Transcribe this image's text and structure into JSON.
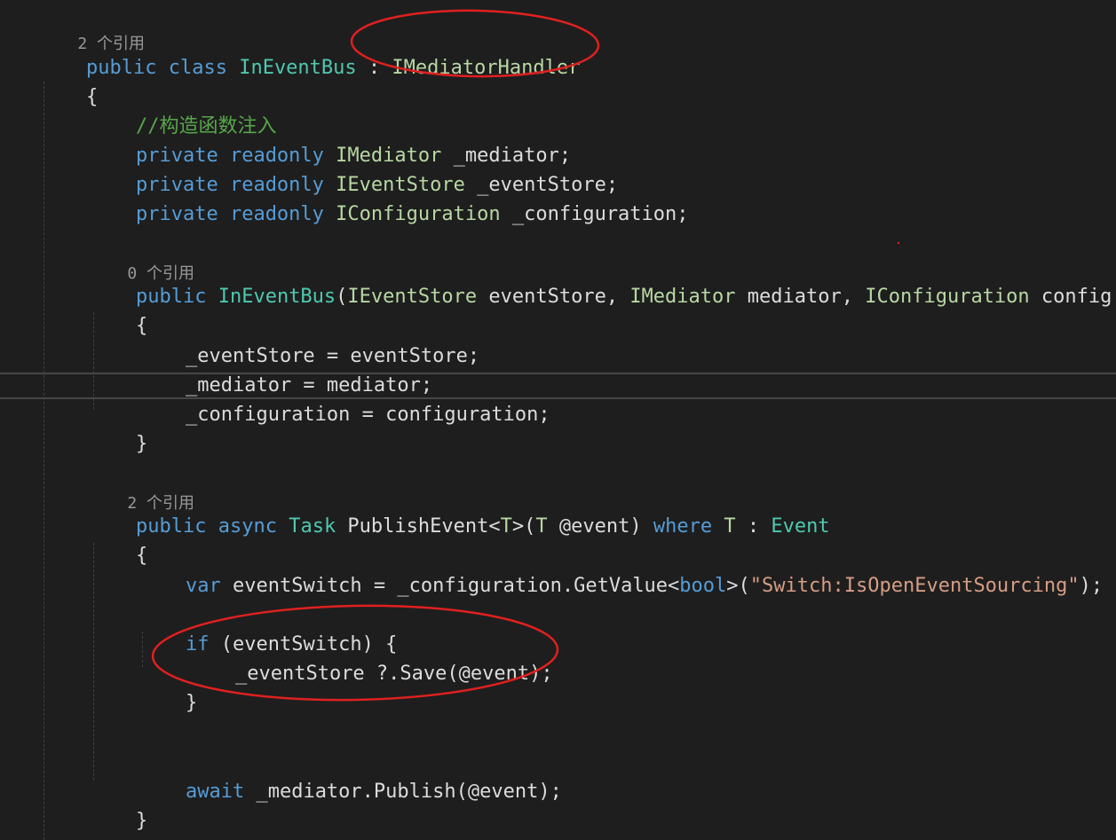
{
  "colors": {
    "background": "#1e1e1e",
    "keyword": "#569cd6",
    "type": "#4ec9b0",
    "interface": "#b8d7a3",
    "identifier": "#dcdcdc",
    "string": "#d69d85",
    "comment": "#57a64a",
    "codelens": "#999999",
    "annotation": "#e02020"
  },
  "code": {
    "class_refs": "2 个引用",
    "class_decl": {
      "kw1": "public",
      "kw2": "class",
      "name": "InEventBus",
      "colon": " : ",
      "base": "IMediatorHandler"
    },
    "open_brace": "{",
    "comment": "//构造函数注入",
    "field1": {
      "kw1": "private",
      "kw2": "readonly",
      "type": "IMediator",
      "name": " _mediator;"
    },
    "field2": {
      "kw1": "private",
      "kw2": "readonly",
      "type": "IEventStore",
      "name": " _eventStore;"
    },
    "field3": {
      "kw1": "private",
      "kw2": "readonly",
      "type": "IConfiguration",
      "name": " _configuration;"
    },
    "ctor_refs": "0 个引用",
    "ctor_decl": {
      "kw": "public",
      "name": "InEventBus",
      "p_open": "(",
      "t1": "IEventStore",
      "n1": " eventStore, ",
      "t2": "IMediator",
      "n2": " mediator, ",
      "t3": "IConfiguration",
      "n3": " config"
    },
    "ctor_body": [
      "_eventStore = eventStore;",
      "_mediator = mediator;",
      "_configuration = configuration;"
    ],
    "close_brace": "}",
    "method_refs": "2 个引用",
    "method_decl": {
      "kw1": "public",
      "kw2": "async",
      "ret": "Task",
      "name": " PublishEvent<",
      "tp": "T",
      "mid": ">(",
      "tp2": "T",
      "param": " @event) ",
      "where": "where",
      "tp3": "T",
      "colon": " : ",
      "constraint": "Event"
    },
    "var_line": {
      "kw": "var",
      "rest1": " eventSwitch = _configuration.GetValue<",
      "bool": "bool",
      "rest2": ">(",
      "str": "\"Switch:IsOpenEventSourcing\"",
      "rest3": ");"
    },
    "if_line": {
      "kw": "if",
      "rest": " (eventSwitch) {"
    },
    "save_line": "_eventStore ?.Save(@event);",
    "inner_close": "}",
    "await_line": {
      "kw": "await",
      "rest": " _mediator.Publish(@event);"
    }
  }
}
